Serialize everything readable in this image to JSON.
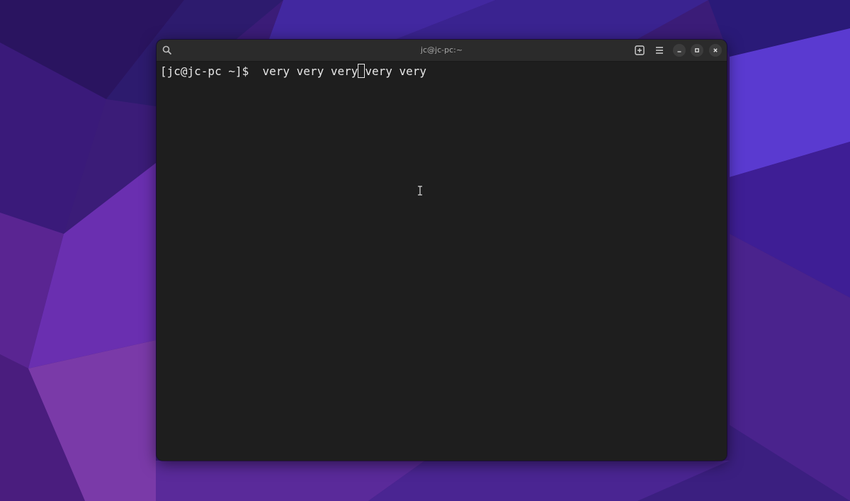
{
  "window": {
    "title": "jc@jc-pc:~"
  },
  "headerbar": {
    "icons": [
      "search-icon",
      "new-tab-icon",
      "hamburger-menu-icon",
      "minimize-icon",
      "maximize-icon",
      "close-icon"
    ]
  },
  "terminal": {
    "prompt": "[jc@jc-pc ~]$  ",
    "command_before_cursor": "very very very",
    "command_after_cursor": "very very"
  },
  "colors": {
    "terminal_bg": "#1e1e1e",
    "headerbar_bg": "#2b2b2b",
    "text": "#e8e8e8",
    "title_text": "#a9a9a9",
    "desktop_accent": "#5b2bb0"
  }
}
